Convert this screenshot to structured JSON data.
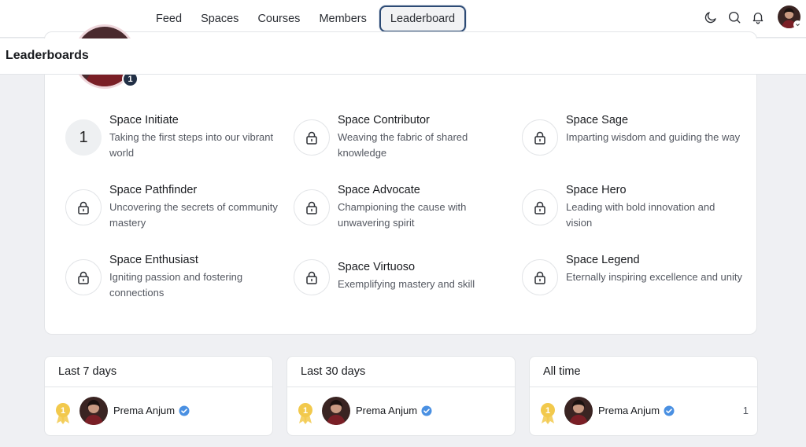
{
  "nav": {
    "links": [
      {
        "label": "Feed"
      },
      {
        "label": "Spaces"
      },
      {
        "label": "Courses"
      },
      {
        "label": "Members"
      },
      {
        "label": "Leaderboard"
      }
    ],
    "icons": [
      "moon-icon",
      "search-icon",
      "bell-icon"
    ]
  },
  "page": {
    "title": "Leaderboards"
  },
  "profile": {
    "level": "1"
  },
  "levels": [
    {
      "number": "1",
      "title": "Space Initiate",
      "desc": "Taking the first steps into our vibrant world",
      "locked": false
    },
    {
      "number": "",
      "title": "Space Contributor",
      "desc": "Weaving the fabric of shared knowledge",
      "locked": true
    },
    {
      "number": "",
      "title": "Space Sage",
      "desc": "Imparting wisdom and guiding the way",
      "locked": true
    },
    {
      "number": "",
      "title": "Space Pathfinder",
      "desc": "Uncovering the secrets of community mastery",
      "locked": true
    },
    {
      "number": "",
      "title": "Space Advocate",
      "desc": "Championing the cause with unwavering spirit",
      "locked": true
    },
    {
      "number": "",
      "title": "Space Hero",
      "desc": "Leading with bold innovation and vision",
      "locked": true
    },
    {
      "number": "",
      "title": "Space Enthusiast",
      "desc": "Igniting passion and fostering connections",
      "locked": true
    },
    {
      "number": "",
      "title": "Space Virtuoso",
      "desc": "Exemplifying mastery and skill",
      "locked": true
    },
    {
      "number": "",
      "title": "Space Legend",
      "desc": "Eternally inspiring excellence and unity",
      "locked": true
    }
  ],
  "leaderboards": [
    {
      "title": "Last 7 days",
      "rank": "1",
      "name": "Prema Anjum",
      "points": ""
    },
    {
      "title": "Last 30 days",
      "rank": "1",
      "name": "Prema Anjum",
      "points": ""
    },
    {
      "title": "All time",
      "rank": "1",
      "name": "Prema Anjum",
      "points": "1"
    }
  ],
  "colors": {
    "accent": "#2c4a74",
    "medal": "#f2c94c",
    "verified": "#4a90e2"
  }
}
